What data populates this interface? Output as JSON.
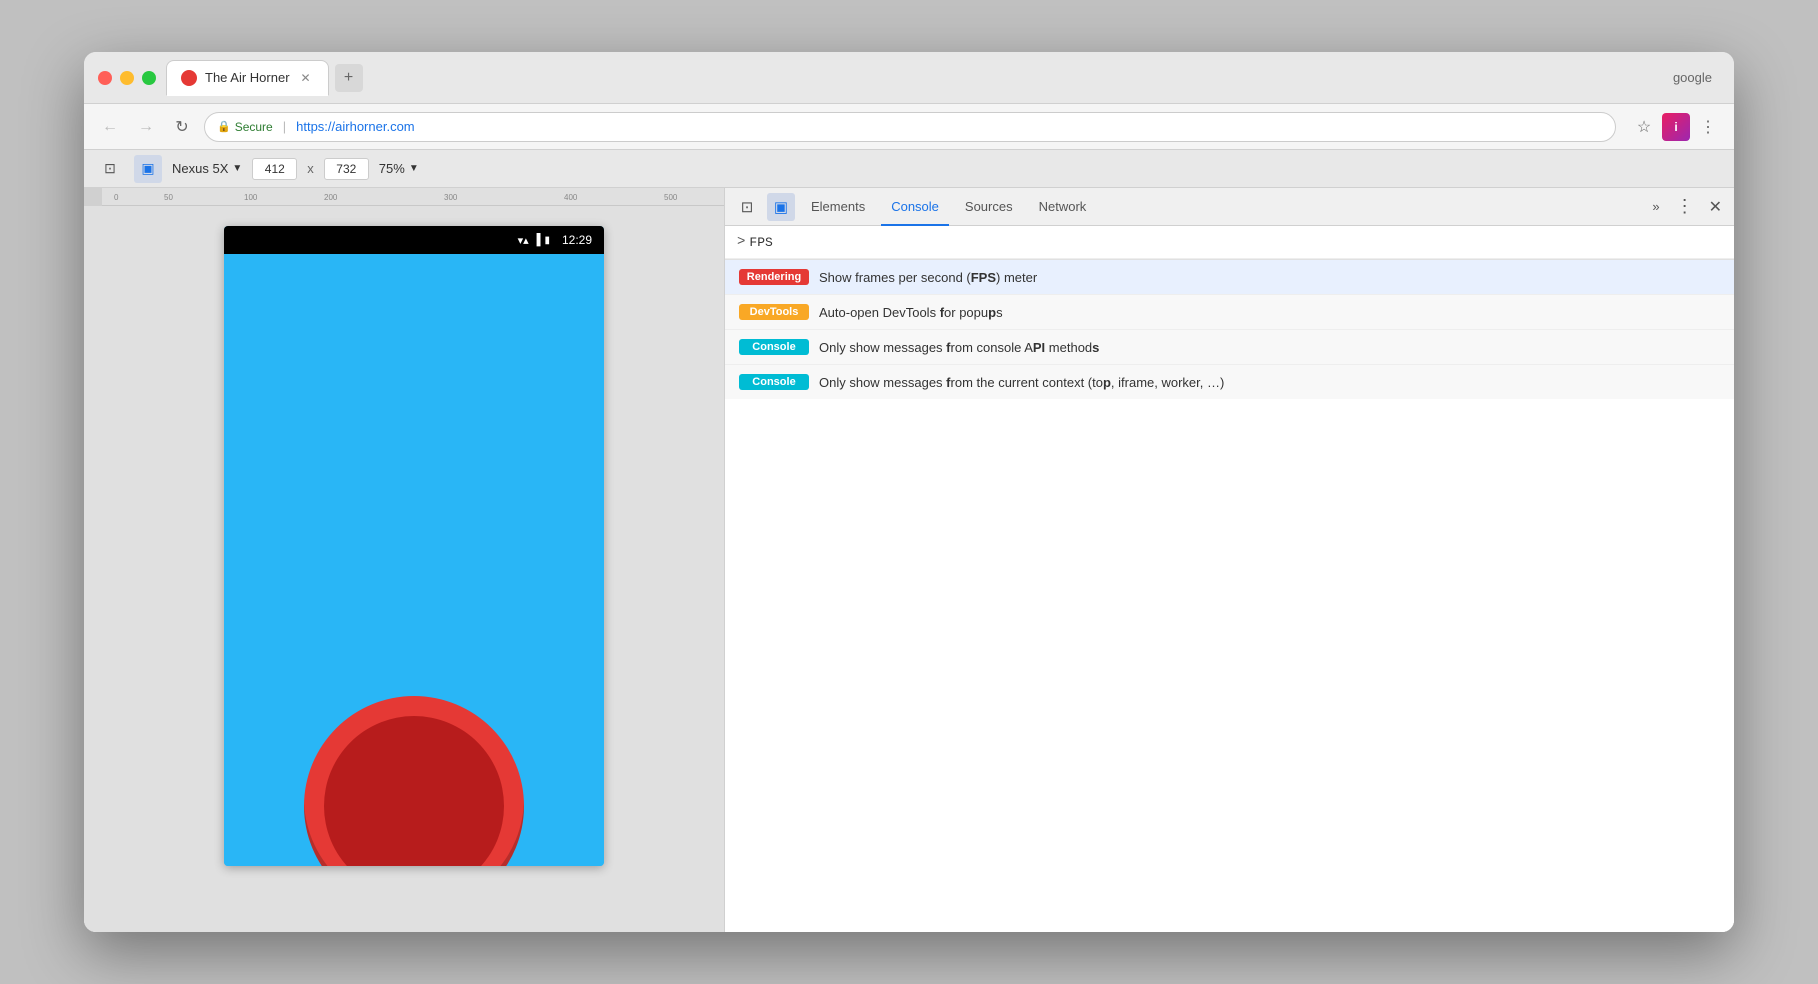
{
  "browser": {
    "tab": {
      "title": "The Air Horner",
      "favicon_color": "#e53935"
    },
    "tab_new_label": "+",
    "google_label": "google",
    "nav": {
      "back_icon": "←",
      "forward_icon": "→",
      "refresh_icon": "↻",
      "secure_label": "Secure",
      "url": "https://airhorner.com",
      "star_icon": "☆",
      "extensions_label": "i",
      "menu_icon": "⋮"
    }
  },
  "device_toolbar": {
    "device_name": "Nexus 5X",
    "width": "412",
    "x_separator": "x",
    "height": "732",
    "zoom": "75%",
    "inspect_icon": "⊡",
    "responsive_icon": "▣"
  },
  "devtools": {
    "inspect_btn": "⊡",
    "device_btn": "▣",
    "tabs": [
      {
        "label": "Elements",
        "active": false
      },
      {
        "label": "Console",
        "active": true
      },
      {
        "label": "Sources",
        "active": false
      },
      {
        "label": "Network",
        "active": false
      }
    ],
    "more_btn": "»",
    "kebab_btn": "⋮",
    "close_btn": "✕"
  },
  "console": {
    "prompt": ">",
    "input_text": "FPS",
    "autocomplete_items": [
      {
        "tag": "Rendering",
        "tag_class": "tag-rendering",
        "description_parts": [
          {
            "text": "Show frames per second ("
          },
          {
            "text": "FPS",
            "bold": true
          },
          {
            "text": ") meter"
          }
        ],
        "description": "Show frames per second (FPS) meter"
      },
      {
        "tag": "DevTools",
        "tag_class": "tag-devtools",
        "description_parts": [
          {
            "text": "Auto-open DevTools "
          },
          {
            "text": "f",
            "bold": true
          },
          {
            "text": "or popu"
          },
          {
            "text": "p",
            "bold": true
          },
          {
            "text": "s"
          }
        ],
        "description": "Auto-open DevTools for popups"
      },
      {
        "tag": "Console",
        "tag_class": "tag-console",
        "description_parts": [
          {
            "text": "Only show messages "
          },
          {
            "text": "f",
            "bold": true
          },
          {
            "text": "rom console A"
          },
          {
            "text": "PI",
            "bold": true
          },
          {
            "text": " method"
          },
          {
            "text": "s",
            "bold": true
          }
        ],
        "description": "Only show messages from console API methods"
      },
      {
        "tag": "Console",
        "tag_class": "tag-console",
        "description_parts": [
          {
            "text": "Only show messages "
          },
          {
            "text": "f",
            "bold": true
          },
          {
            "text": "rom the current context (to"
          },
          {
            "text": "p",
            "bold": true
          },
          {
            "text": ", iframe, worker, …"
          }
        ],
        "description": "Only show messages from the current context (top, iframe, worker, …)"
      }
    ]
  },
  "phone": {
    "time": "12:29",
    "bg_color": "#29b6f6",
    "button_color": "#e53935"
  }
}
